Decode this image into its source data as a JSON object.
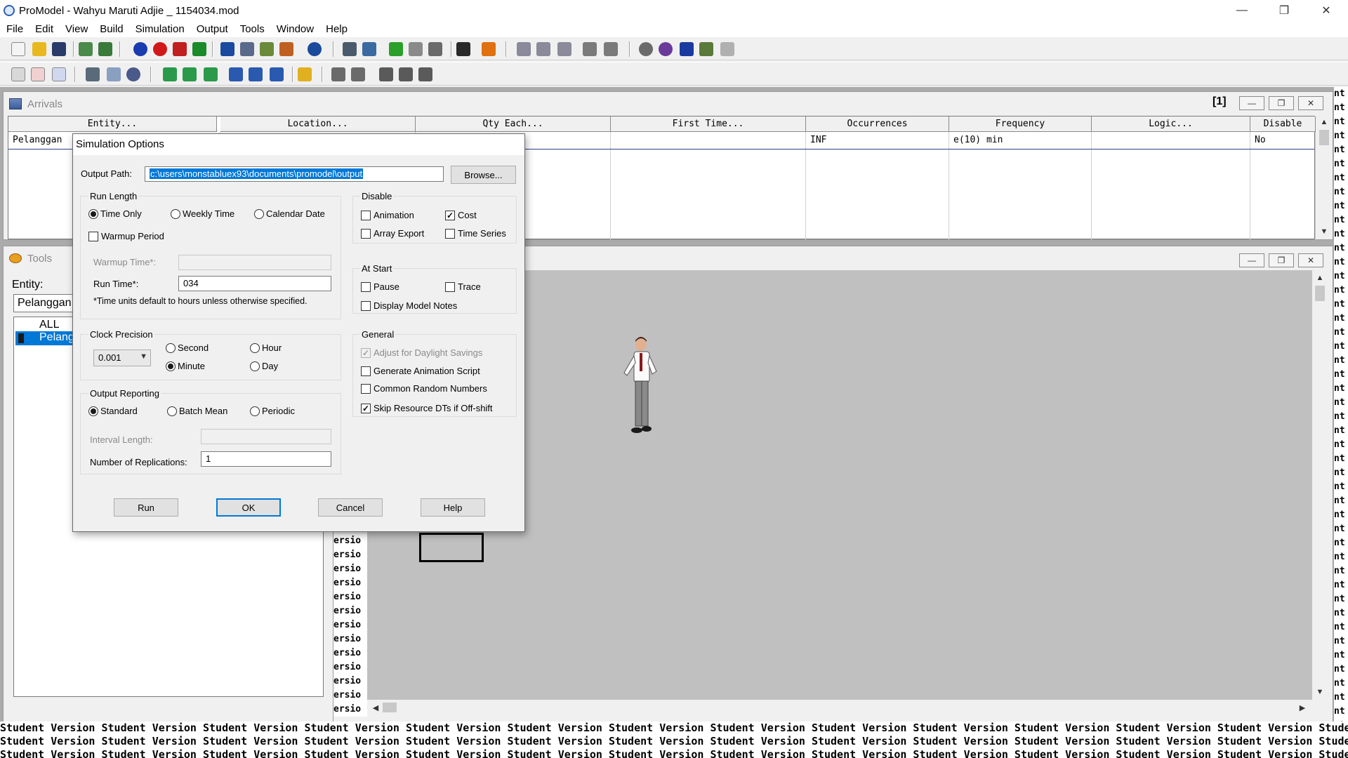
{
  "window": {
    "title": "ProModel - Wahyu Maruti Adjie _ 1154034.mod",
    "minimize": "—",
    "restore": "❐",
    "close": "✕"
  },
  "menu": [
    "File",
    "Edit",
    "View",
    "Build",
    "Simulation",
    "Output",
    "Tools",
    "Window",
    "Help"
  ],
  "arrivals": {
    "title": "Arrivals",
    "counter": "[1]",
    "columns": [
      "Entity...",
      "Location...",
      "Qty Each...",
      "First Time...",
      "Occurrences",
      "Frequency",
      "Logic...",
      "Disable"
    ],
    "row": {
      "entity": "Pelanggan",
      "occurrences": "INF",
      "frequency": "e(10) min",
      "disable": "No"
    }
  },
  "tools": {
    "title": "Tools",
    "entity_label": "Entity:",
    "entity_value": "Pelanggan",
    "list": [
      "ALL",
      "Pelanggan"
    ]
  },
  "watermark": {
    "text": "Student Version",
    "strip": "nt",
    "partial": "ersio"
  },
  "dialog": {
    "title": "Simulation Options",
    "output_path_label": "Output Path:",
    "output_path_value": "c:\\users\\monstabluex93\\documents\\promodel\\output",
    "browse": "Browse...",
    "run_length": {
      "title": "Run Length",
      "options": [
        "Time Only",
        "Weekly Time",
        "Calendar Date"
      ],
      "selected": "Time Only",
      "warmup_period": "Warmup Period",
      "warmup_time_label": "Warmup Time*:",
      "run_time_label": "Run Time*:",
      "run_time_value": "034",
      "note": "*Time units default to hours unless otherwise specified."
    },
    "clock_precision": {
      "title": "Clock Precision",
      "value": "0.001",
      "units": [
        "Second",
        "Hour",
        "Minute",
        "Day"
      ],
      "selected": "Minute"
    },
    "output_reporting": {
      "title": "Output Reporting",
      "options": [
        "Standard",
        "Batch Mean",
        "Periodic"
      ],
      "selected": "Standard",
      "interval_length_label": "Interval Length:",
      "replications_label": "Number of Replications:",
      "replications_value": "1"
    },
    "disable": {
      "title": "Disable",
      "animation": "Animation",
      "cost": "Cost",
      "array_export": "Array Export",
      "time_series": "Time Series"
    },
    "at_start": {
      "title": "At Start",
      "pause": "Pause",
      "trace": "Trace",
      "display_model_notes": "Display Model Notes"
    },
    "general": {
      "title": "General",
      "daylight": "Adjust for Daylight Savings",
      "animation_script": "Generate Animation Script",
      "common_random": "Common Random Numbers",
      "skip_resource": "Skip Resource DTs if Off-shift"
    },
    "buttons": {
      "run": "Run",
      "ok": "OK",
      "cancel": "Cancel",
      "help": "Help"
    }
  },
  "colors": {
    "selection": "#0078d7",
    "layout_bg": "#c0c0c0",
    "mdi_bg": "#ababab"
  }
}
